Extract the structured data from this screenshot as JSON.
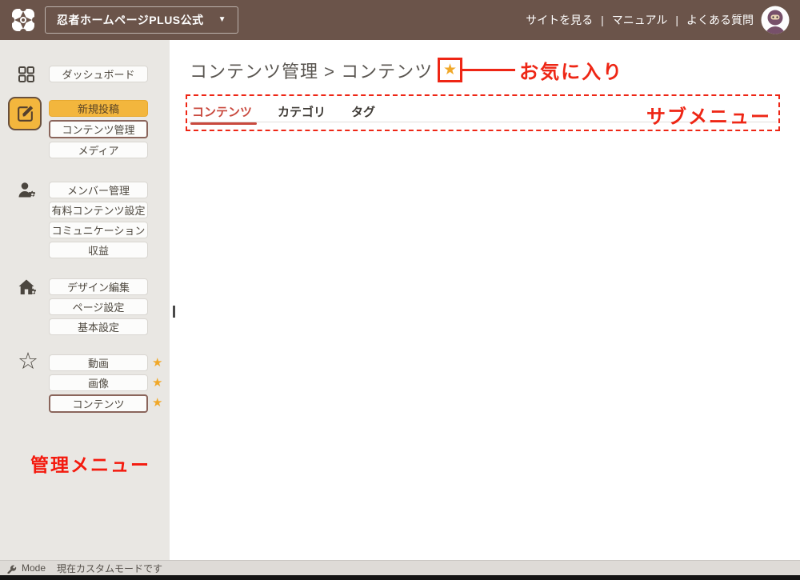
{
  "topbar": {
    "site_selector_label": "忍者ホームページPLUS公式",
    "dropdown_caret": "▼",
    "links": [
      "サイトを見る",
      "マニュアル",
      "よくある質問"
    ],
    "link_separator": "|"
  },
  "sidebar": {
    "annotation": "管理メニュー",
    "star_glyph": "★",
    "outline_star_glyph": "☆",
    "groups": [
      {
        "icon": "dashboard-icon",
        "items": [
          {
            "label": "ダッシュボード",
            "style": "normal",
            "starred": false
          }
        ]
      },
      {
        "icon": "edit-square-icon",
        "items": [
          {
            "label": "新規投稿",
            "style": "primary",
            "starred": false
          },
          {
            "label": "コンテンツ管理",
            "style": "outlined",
            "starred": false
          },
          {
            "label": "メディア",
            "style": "normal",
            "starred": false
          }
        ]
      },
      {
        "icon": "member-settings-icon",
        "items": [
          {
            "label": "メンバー管理",
            "style": "normal",
            "starred": false
          },
          {
            "label": "有料コンテンツ設定",
            "style": "normal",
            "starred": false
          },
          {
            "label": "コミュニケーション",
            "style": "normal",
            "starred": false
          },
          {
            "label": "収益",
            "style": "normal",
            "starred": false
          }
        ]
      },
      {
        "icon": "site-settings-icon",
        "items": [
          {
            "label": "デザイン編集",
            "style": "normal",
            "starred": false
          },
          {
            "label": "ページ設定",
            "style": "normal",
            "starred": false
          },
          {
            "label": "基本設定",
            "style": "normal",
            "starred": false
          }
        ]
      },
      {
        "icon": "favorites-star-icon",
        "items": [
          {
            "label": "動画",
            "style": "normal",
            "starred": true
          },
          {
            "label": "画像",
            "style": "normal",
            "starred": true
          },
          {
            "label": "コンテンツ",
            "style": "outlined",
            "starred": true
          }
        ]
      }
    ]
  },
  "main": {
    "breadcrumb": "コンテンツ管理 > コンテンツ",
    "favorite_star_glyph": "★",
    "favorite_annotation": "お気に入り",
    "submenu_annotation": "サブメニュー",
    "tabs": [
      {
        "label": "コンテンツ",
        "active": true
      },
      {
        "label": "カテゴリ",
        "active": false
      },
      {
        "label": "タグ",
        "active": false
      }
    ]
  },
  "statusbar": {
    "mode_label": "Mode",
    "mode_text": "現在カスタムモードです"
  },
  "colors": {
    "topbar_brown": "#6B544A",
    "sidebar_gray": "#E9E7E3",
    "accent_yellow": "#F3B63D",
    "annotation_red": "#EE2615",
    "active_tab_red": "#C9493E",
    "star_orange": "#F0A829"
  }
}
